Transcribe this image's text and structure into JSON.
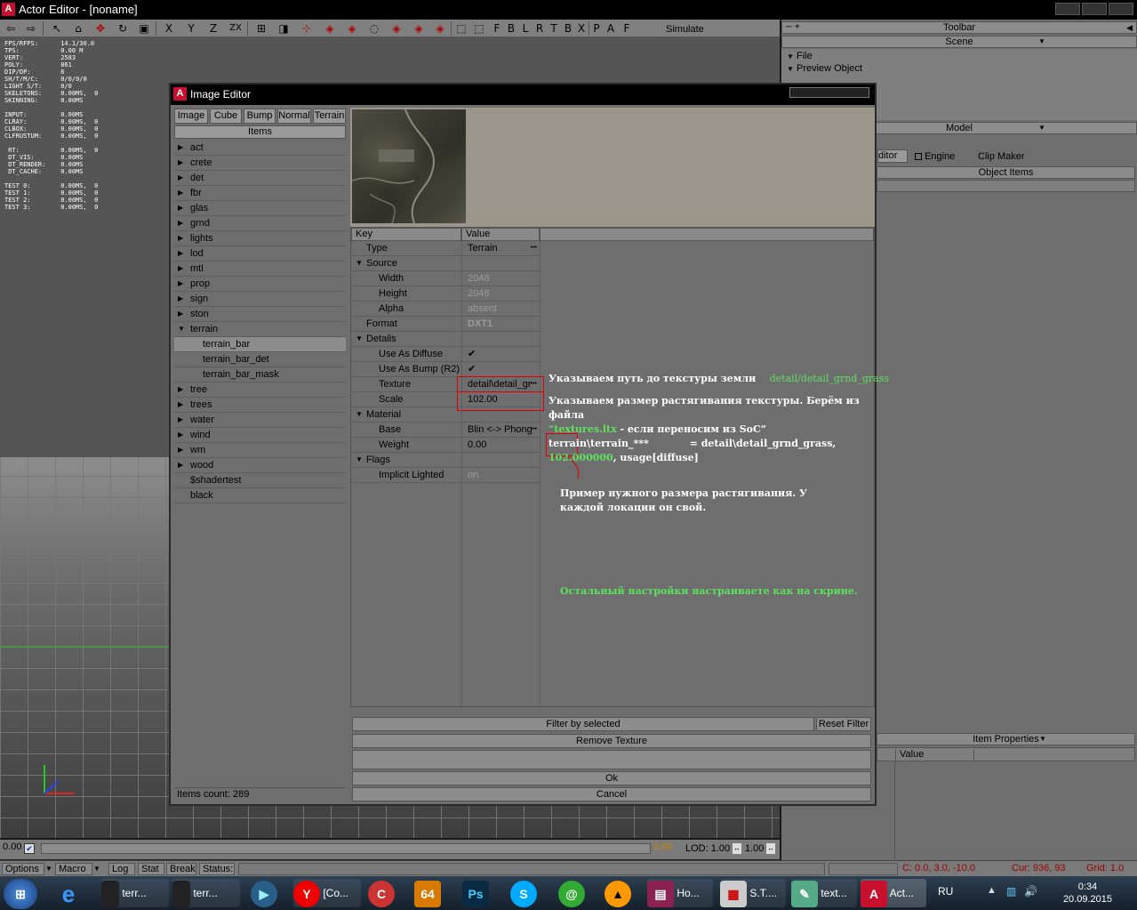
{
  "window": {
    "title": "Actor Editor - [noname]",
    "logo": "A"
  },
  "toolbar": {
    "icons": [
      "arrow-left-icon",
      "arrow-right-icon",
      "select-icon",
      "camera-icon",
      "move-icon",
      "rotate-icon",
      "scale-icon"
    ],
    "axis_labels": [
      "X",
      "Y",
      "Z",
      "ZX"
    ],
    "snap_labels": [
      "F",
      "B",
      "L",
      "R",
      "T",
      "B",
      "X"
    ],
    "mode_labels": [
      "P",
      "A",
      "F"
    ],
    "simulate_label": "Simulate"
  },
  "stats": "FPS/RFPS:      14.1/30.0\nTPS:           0.00 M\nVERT:          2583\nPOLY:          861\nDIP/DP:        6\nSH/T/M/C:      0/0/0/0\nLIGHT S/T:     0/0\nSKELETONS:     0.00MS,  0\nSKINNING:      0.00MS\n\nINPUT:         0.00MS\nCLRAY:         0.00MS,  0\nCLBOX:         0.00MS,  0\nCLFRUSTUM:     0.00MS,  0\n\n RT:           0.00MS,  0\n DT_VIS:       0.00MS\n DT_RENDER:    0.00MS\n DT_CACHE:     0.00MS\n\nTEST 0:        0.00MS,  0\nTEST 1:        0.00MS,  0\nTEST 2:        0.00MS,  0\nTEST 3:        0.00MS,  0",
  "dialog": {
    "title": "Image Editor",
    "tabs": [
      "Image",
      "Cube",
      "Bump",
      "Normal",
      "Terrain"
    ],
    "items_header": "Items",
    "items": [
      {
        "label": "act",
        "expanded": false
      },
      {
        "label": "crete",
        "expanded": false
      },
      {
        "label": "det",
        "expanded": false
      },
      {
        "label": "fbr",
        "expanded": false
      },
      {
        "label": "glas",
        "expanded": false
      },
      {
        "label": "grnd",
        "expanded": false
      },
      {
        "label": "lights",
        "expanded": false
      },
      {
        "label": "lod",
        "expanded": false
      },
      {
        "label": "mtl",
        "expanded": false
      },
      {
        "label": "prop",
        "expanded": false
      },
      {
        "label": "sign",
        "expanded": false
      },
      {
        "label": "ston",
        "expanded": false
      },
      {
        "label": "terrain",
        "expanded": true
      },
      {
        "label": "terrain_bar",
        "child": true,
        "selected": true
      },
      {
        "label": "terrain_bar_det",
        "child": true
      },
      {
        "label": "terrain_bar_mask",
        "child": true
      },
      {
        "label": "tree",
        "expanded": false
      },
      {
        "label": "trees",
        "expanded": false
      },
      {
        "label": "water",
        "expanded": false
      },
      {
        "label": "wind",
        "expanded": false
      },
      {
        "label": "wm",
        "expanded": false
      },
      {
        "label": "wood",
        "expanded": false
      },
      {
        "label": "$shadertest",
        "leaf": true
      },
      {
        "label": "black",
        "leaf": true
      }
    ],
    "items_count": "Items count: 289",
    "props_header": {
      "key": "Key",
      "value": "Value"
    },
    "props": [
      {
        "key": "Type",
        "value": "Terrain",
        "level": 0,
        "dots": true
      },
      {
        "key": "Source",
        "value": "",
        "level": 0,
        "group": true
      },
      {
        "key": "Width",
        "value": "2048",
        "level": 1,
        "disabled": true
      },
      {
        "key": "Height",
        "value": "2048",
        "level": 1,
        "disabled": true
      },
      {
        "key": "Alpha",
        "value": "absent",
        "level": 1,
        "disabled": true
      },
      {
        "key": "Format",
        "value": "DXT1",
        "level": 0,
        "disabled": true
      },
      {
        "key": "Details",
        "value": "",
        "level": 0,
        "group": true
      },
      {
        "key": "Use As Diffuse",
        "value": "✔",
        "level": 1
      },
      {
        "key": "Use As Bump (R2)",
        "value": "✔",
        "level": 1
      },
      {
        "key": "Texture",
        "value": "detail\\detail_gr",
        "level": 1,
        "dots": true
      },
      {
        "key": "Scale",
        "value": "102.00",
        "level": 1
      },
      {
        "key": "Material",
        "value": "",
        "level": 0,
        "group": true
      },
      {
        "key": "Base",
        "value": "Blin <-> Phong",
        "level": 1,
        "dots": true
      },
      {
        "key": "Weight",
        "value": "0.00",
        "level": 1
      },
      {
        "key": "Flags",
        "value": "",
        "level": 0,
        "group": true
      },
      {
        "key": "Implicit Lighted",
        "value": "on",
        "level": 1,
        "disabled": true
      }
    ],
    "buttons": {
      "filter_by_selected": "Filter by selected",
      "reset_filter": "Reset Filter",
      "remove_texture": "Remove Texture",
      "ok": "Ok",
      "cancel": "Cancel"
    }
  },
  "annotations": {
    "a1_text": "Указываем путь до текстуры земли",
    "a1_path": "detail/detail_grnd_grass",
    "a2_line1": "Указываем размер растягивания текстуры. Берём из файла",
    "a2_file": "“textures.ltx",
    "a2_line2_rest": " - если переносим из SoC”",
    "a2_line3": "terrain\\terrain_***            = detail\\detail_grnd_grass,",
    "a2_value": "102.000000",
    "a2_line4_rest": ", usage[diffuse]",
    "a3_line1": "Пример нужного размера растягивания. У",
    "a3_line2": "каждой локации он свой.",
    "a4": "Остальный настройки настраиваете как на скрине."
  },
  "right_panel": {
    "toolbar_title": "Toolbar",
    "scene_title": "Scene",
    "scene_items": [
      "File",
      "Preview Object"
    ],
    "model_title": "Model",
    "model_tab_editor": "ditor",
    "engine_label": "Engine",
    "clip_maker_label": "Clip Maker",
    "object_items": "Object Items",
    "item_properties": "Item Properties",
    "value_col": "Value"
  },
  "bottom": {
    "left_value": "0.00",
    "right_value": "0.00",
    "lod_label": "LOD: 1.00",
    "lod_value2": "1.00"
  },
  "statusbar": {
    "options": "Options",
    "macro": "Macro",
    "log": "Log",
    "stat": "Stat",
    "break": "Break",
    "status": "Status:",
    "cam": "C: 0.0, 3.0, -10.0",
    "cur": "Cur: 936, 93",
    "grid": "Grid: 1.0"
  },
  "taskbar": {
    "items": [
      "terr...",
      "terr...",
      "[Co...",
      "Ho...",
      "S.T....",
      "text...",
      "Act..."
    ],
    "lang": "RU",
    "time": "0:34",
    "date": "20.09.2015"
  }
}
